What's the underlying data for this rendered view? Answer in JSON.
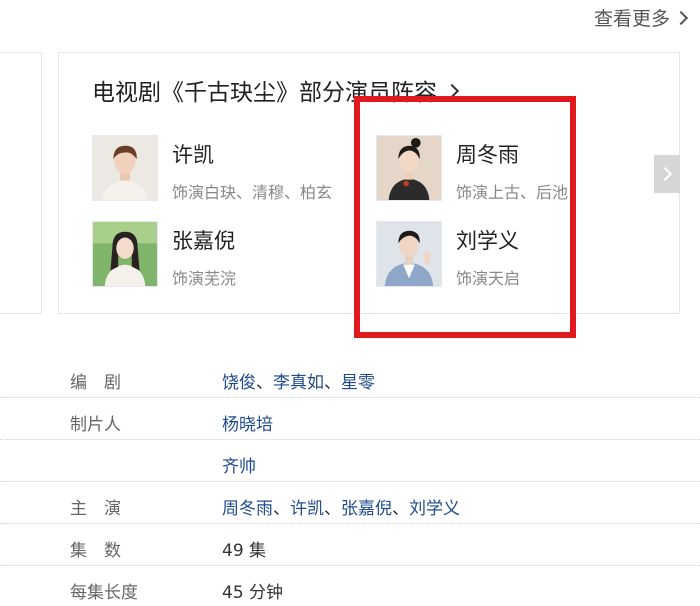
{
  "header": {
    "see_more": "查看更多"
  },
  "cast": {
    "title": "电视剧《千古玦尘》部分演员阵容",
    "members": [
      {
        "name": "许凯",
        "role": "饰演白玦、清穆、柏玄"
      },
      {
        "name": "周冬雨",
        "role": "饰演上古、后池"
      },
      {
        "name": "张嘉倪",
        "role": "饰演芜浣"
      },
      {
        "name": "刘学义",
        "role": "饰演天启"
      }
    ]
  },
  "info": {
    "screenwriter": {
      "label": "编　剧",
      "values": [
        "饶俊",
        "李真如",
        "星零"
      ],
      "separator": "、"
    },
    "producer": {
      "label": "制片人",
      "values": [
        "杨晓培"
      ]
    },
    "producer2": {
      "label": "",
      "values": [
        "齐帅"
      ]
    },
    "starring": {
      "label": "主　演",
      "values": [
        "周冬雨",
        "许凯",
        "张嘉倪",
        "刘学义"
      ],
      "separator": "、"
    },
    "episodes": {
      "label": "集　数",
      "value": "49 集"
    },
    "duration": {
      "label": "每集长度",
      "value": "45 分钟"
    }
  },
  "colors": {
    "link": "#1f4a8f",
    "highlight": "#e0191e",
    "muted": "#888888"
  }
}
